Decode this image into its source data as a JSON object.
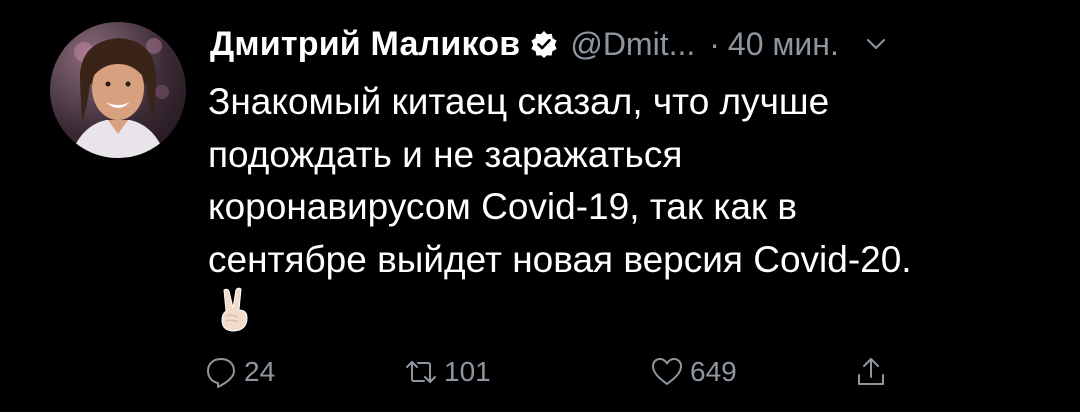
{
  "tweet": {
    "author_name": "Дмитрий Маликов",
    "handle": "@Dmit...",
    "separator": "·",
    "time": "40 мин.",
    "lines": [
      "Знакомый китаец сказал, что лучше",
      "подождать и не заражаться",
      "коронавирусом Covid-19, так как в",
      "сентябре выйдет новая версия Covid-20."
    ],
    "emoji": "✌🏻",
    "actions": {
      "reply_count": "24",
      "retweet_count": "101",
      "like_count": "649"
    }
  },
  "icons": {
    "verified": "verified-badge-icon",
    "chevron": "chevron-down-icon",
    "reply": "reply-icon",
    "retweet": "retweet-icon",
    "like": "heart-icon",
    "share": "share-icon"
  },
  "colors": {
    "background": "#000000",
    "text": "#ffffff",
    "muted": "#8e979f"
  }
}
